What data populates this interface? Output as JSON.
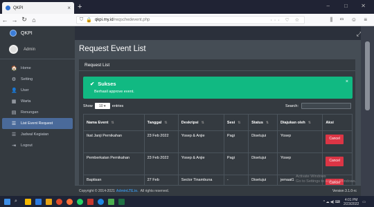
{
  "browser": {
    "tab_title": "QKPI",
    "url_host": "qkpi.my.id",
    "url_path": "/reqschedevent.php",
    "url_actions": "··· ♡ ☆",
    "toolbar_icons": "⫼ ▭ ☺ ≡",
    "win_min": "–",
    "win_max": "□",
    "win_close": "✕"
  },
  "app": {
    "brand": "QKPI",
    "user": "Admin"
  },
  "sidebar": {
    "items": [
      {
        "label": "Home",
        "icon": "🏠",
        "icon_name": "home-icon",
        "active": false
      },
      {
        "label": "Setting",
        "icon": "⚙",
        "icon_name": "gear-icon",
        "active": false
      },
      {
        "label": "User",
        "icon": "👤",
        "icon_name": "user-icon",
        "active": false
      },
      {
        "label": "Warta",
        "icon": "▦",
        "icon_name": "newspaper-icon",
        "active": false
      },
      {
        "label": "Renungan",
        "icon": "▤",
        "icon_name": "book-icon",
        "active": false
      },
      {
        "label": "List Event Request",
        "icon": "☰",
        "icon_name": "list-icon",
        "active": true
      },
      {
        "label": "Jadwal Kegiatan",
        "icon": "☰",
        "icon_name": "list-icon",
        "active": false
      },
      {
        "label": "Logout",
        "icon": "⇥",
        "icon_name": "logout-icon",
        "active": false
      }
    ]
  },
  "main": {
    "title": "Request Event List",
    "card_header": "Request List",
    "alert": {
      "title": "Sukses",
      "text": "Berhasil approve event.",
      "close": "×"
    },
    "show_label": "Show",
    "show_value": "10",
    "entries_label": "entries",
    "search_label": "Search:",
    "columns": [
      "Nama Event",
      "Tanggal",
      "Deskripsi",
      "Sesi",
      "Status",
      "Diajukan oleh",
      "Aksi"
    ],
    "rows": [
      {
        "event": "Ikat Janji Pernikahan",
        "date": "23 Feb 2022",
        "desc": "Yosep & Anjie",
        "sesi": "Pagi",
        "status": "Disetujui",
        "by": "Yosep",
        "action": "Cancel"
      },
      {
        "event": "Pemberkatan Pernikahan",
        "date": "23 Feb 2022",
        "desc": "Yosep & Anjie",
        "sesi": "Pagi",
        "status": "Disetujui",
        "by": "Yosep",
        "action": "Cancel"
      },
      {
        "event": "Baptisan",
        "date": "27 Feb",
        "desc": "Sector Tinambuna",
        "sesi": "-",
        "status": "Disetujui",
        "by": "jemaat1",
        "action": "Cancel"
      }
    ]
  },
  "footer": {
    "copyright": "Copyright © 2014-2021",
    "link": "AdminLTE.io.",
    "rights": "All rights reserved.",
    "version": "Version 3.1.0-rc"
  },
  "watermark": {
    "line1": "Activate Windows",
    "line2": "Go to Settings to activate Windows."
  },
  "taskbar": {
    "time": "4:01 PM",
    "date": "2/23/2022",
    "tray": "^ ☁ ◀) ⌨"
  },
  "colors": {
    "accent": "#4a6a9a",
    "success": "#11b982",
    "danger": "#dc3545",
    "sidebar_bg": "#343a40",
    "content_bg": "#454d55"
  }
}
